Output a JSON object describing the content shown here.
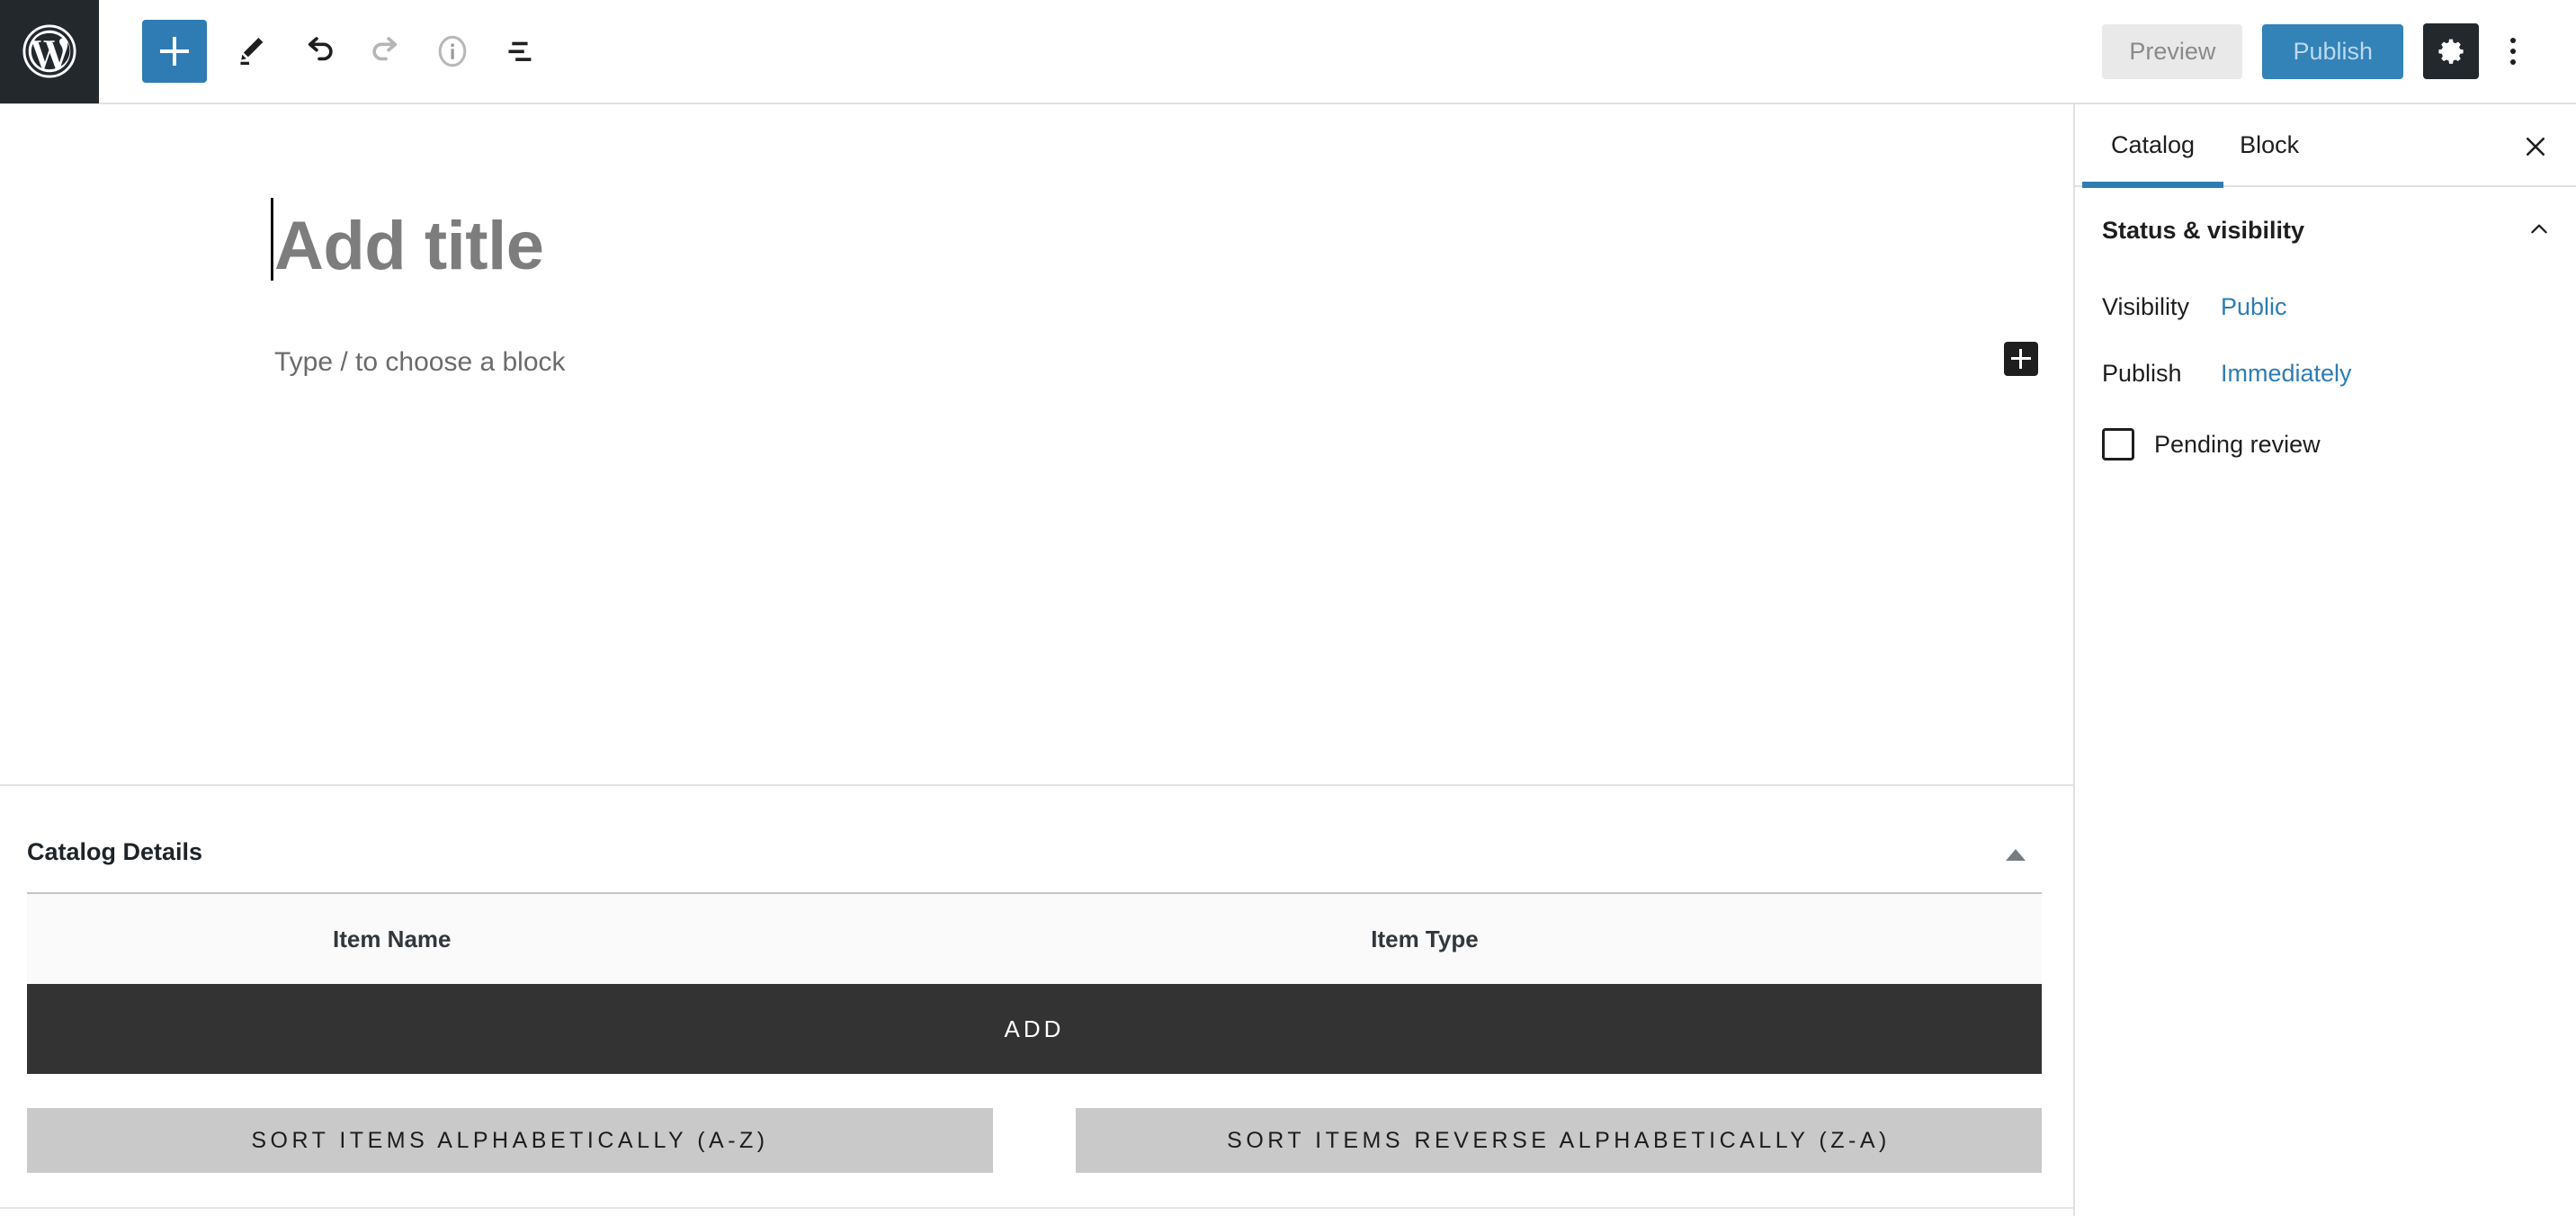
{
  "toolbar": {
    "wp_logo": "wordpress-logo",
    "left_tools": [
      {
        "name": "add-block-button",
        "icon": "plus-icon",
        "label": "Add block"
      },
      {
        "name": "edit-tool-button",
        "icon": "pencil-icon",
        "label": "Tools"
      },
      {
        "name": "undo-button",
        "icon": "undo-arrow-icon",
        "label": "Undo"
      },
      {
        "name": "redo-button",
        "icon": "redo-arrow-icon",
        "label": "Redo"
      },
      {
        "name": "details-button",
        "icon": "info-circle-icon",
        "label": "Details"
      },
      {
        "name": "list-view-button",
        "icon": "list-view-icon",
        "label": "List view"
      }
    ],
    "preview_label": "Preview",
    "publish_label": "Publish",
    "settings_icon": "gear-icon",
    "more_icon": "kebab-menu-icon"
  },
  "editor": {
    "title_placeholder": "Add title",
    "paragraph_placeholder": "Type / to choose a block",
    "inserter_icon": "plus-icon"
  },
  "metabox": {
    "title": "Catalog Details",
    "toggle_icon": "triangle-up-icon",
    "table": {
      "columns": [
        "Item Name",
        "Item Type"
      ],
      "rows": []
    },
    "add_label": "ADD",
    "sort_az_label": "SORT ITEMS ALPHABETICALLY (A-Z)",
    "sort_za_label": "SORT ITEMS REVERSE ALPHABETICALLY (Z-A)"
  },
  "sidebar": {
    "tabs": [
      {
        "label": "Catalog",
        "active": true
      },
      {
        "label": "Block",
        "active": false
      }
    ],
    "close_icon": "close-icon",
    "panel": {
      "title": "Status & visibility",
      "collapse_icon": "chevron-up-icon",
      "rows": [
        {
          "label": "Visibility",
          "value": "Public"
        },
        {
          "label": "Publish",
          "value": "Immediately"
        }
      ],
      "pending_review_label": "Pending review",
      "pending_review_checked": false
    }
  },
  "colors": {
    "accent_blue": "#2e7cb3",
    "publish_blue": "#3382b8",
    "dark": "#23282d",
    "add_bar": "#333333",
    "sort_btn": "#c9c9c9"
  }
}
